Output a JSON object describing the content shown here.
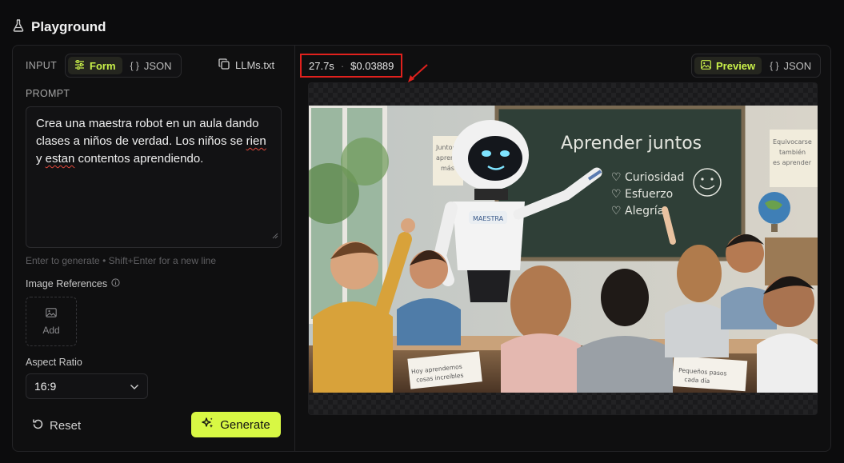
{
  "header": {
    "title": "Playground",
    "icon": "flask-icon"
  },
  "input": {
    "label": "INPUT",
    "tabs": [
      {
        "label": "Form",
        "icon": "sliders-icon",
        "active": true
      },
      {
        "label": "JSON",
        "icon": "braces-icon",
        "active": false
      }
    ],
    "llms_link": "LLMs.txt"
  },
  "prompt": {
    "label": "PROMPT",
    "before": "Crea una maestra robot en un aula dando clases a niños de verdad. Los niños se ",
    "misspelled_1": "rien",
    "middle": " y ",
    "misspelled_2": "estan",
    "after": " contentos aprendiendo.",
    "hint": "Enter to generate • Shift+Enter for a new line"
  },
  "image_references": {
    "label": "Image References",
    "add_label": "Add"
  },
  "aspect_ratio": {
    "label": "Aspect Ratio",
    "value": "16:9"
  },
  "actions": {
    "reset": "Reset",
    "generate": "Generate"
  },
  "output": {
    "time": "27.7s",
    "separator": "·",
    "cost": "$0.03889",
    "tabs": [
      {
        "label": "Preview",
        "icon": "image-icon",
        "active": true
      },
      {
        "label": "JSON",
        "icon": "braces-icon",
        "active": false
      }
    ]
  },
  "image_text": {
    "board_title": "Aprender juntos",
    "board_items": [
      "♡ Curiosidad",
      "♡ Esfuerzo",
      "♡ Alegría"
    ],
    "robot_badge": "MAESTRA",
    "left_poster": [
      "Juntos",
      "aprende",
      "más"
    ],
    "right_poster": [
      "Equivocarse",
      "también",
      "es aprender"
    ],
    "notebook_left": [
      "Hoy aprendemos",
      "cosas increíbles"
    ],
    "notebook_right": [
      "Pequeños pasos",
      "cada día"
    ]
  },
  "colors": {
    "accent": "#d8f844",
    "highlight": "#e0211d",
    "background": "#0c0c0d"
  }
}
